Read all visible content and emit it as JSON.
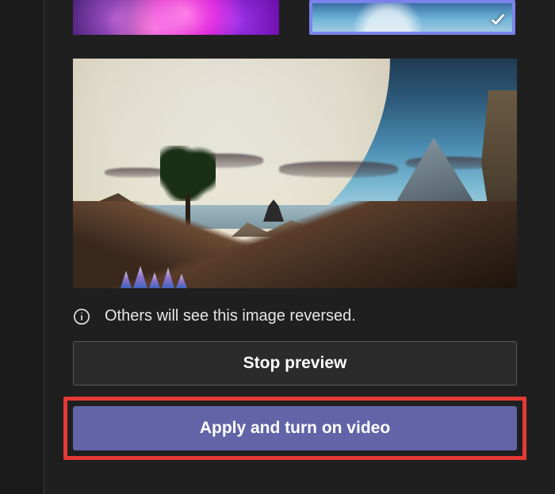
{
  "thumbnails": [
    {
      "name": "nebula-background",
      "selected": false
    },
    {
      "name": "alien-landscape-background",
      "selected": true
    }
  ],
  "info": {
    "icon": "info-icon",
    "text": "Others will see this image reversed."
  },
  "buttons": {
    "secondary_label": "Stop preview",
    "primary_label": "Apply and turn on video"
  },
  "highlight": {
    "target": "apply-button",
    "color": "#e53935"
  },
  "colors": {
    "accent": "#6264a7",
    "panel_bg": "#1f1f1f"
  }
}
